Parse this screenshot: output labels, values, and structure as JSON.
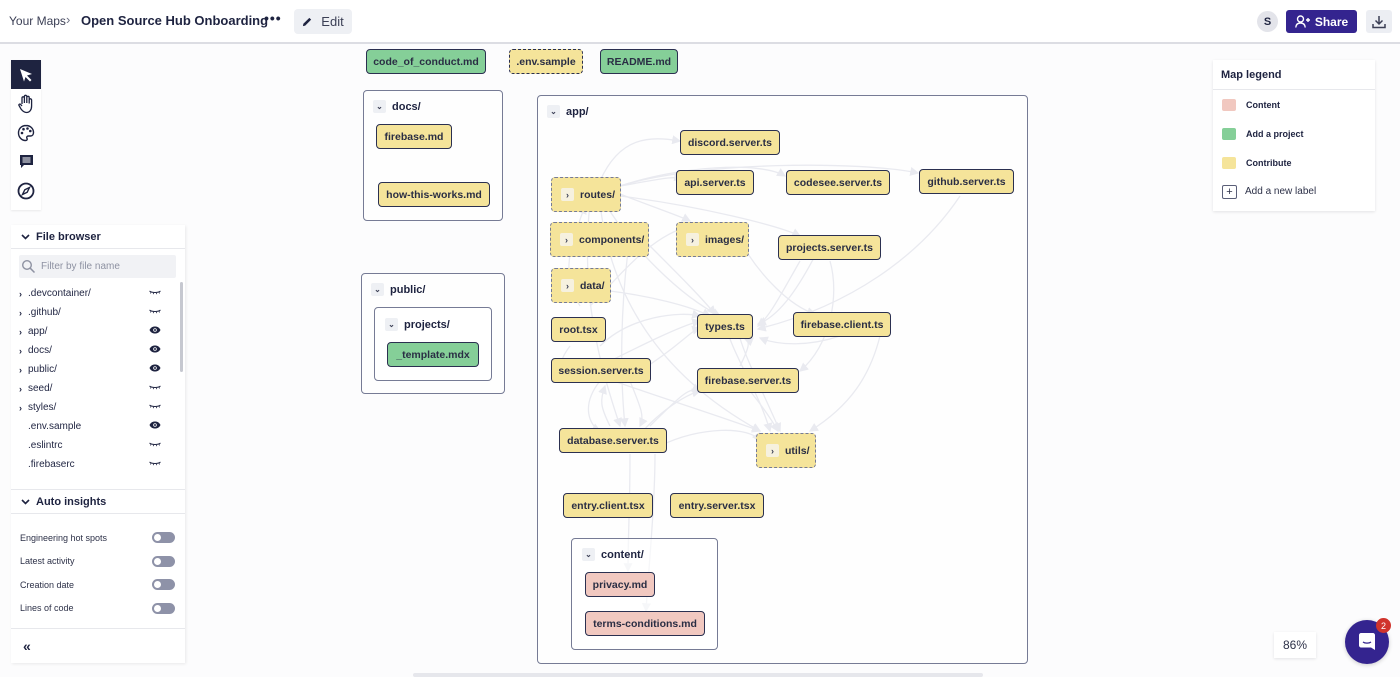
{
  "header": {
    "breadcrumb_root": "Your Maps",
    "breadcrumb_sep": "›",
    "title": "Open Source Hub Onboarding",
    "more_label": "•••",
    "edit_label": "Edit",
    "avatar_initial": "S",
    "share_label": "Share"
  },
  "toolbar": {
    "tools": [
      "select-pointer",
      "pan-hand",
      "palette",
      "comment",
      "compass"
    ],
    "active_tool": "select-pointer"
  },
  "file_browser": {
    "title": "File browser",
    "filter_placeholder": "Filter by file name",
    "items": [
      {
        "name": ".devcontainer/",
        "folder": true,
        "visible": false
      },
      {
        "name": ".github/",
        "folder": true,
        "visible": false
      },
      {
        "name": "app/",
        "folder": true,
        "visible": true
      },
      {
        "name": "docs/",
        "folder": true,
        "visible": true
      },
      {
        "name": "public/",
        "folder": true,
        "visible": true
      },
      {
        "name": "seed/",
        "folder": true,
        "visible": false
      },
      {
        "name": "styles/",
        "folder": true,
        "visible": false
      },
      {
        "name": ".env.sample",
        "folder": false,
        "visible": true
      },
      {
        "name": ".eslintrc",
        "folder": false,
        "visible": false
      },
      {
        "name": ".firebaserc",
        "folder": false,
        "visible": false
      }
    ]
  },
  "auto_insights": {
    "title": "Auto insights",
    "items": [
      {
        "label": "Engineering hot spots",
        "enabled": false
      },
      {
        "label": "Latest activity",
        "enabled": false
      },
      {
        "label": "Creation date",
        "enabled": false
      },
      {
        "label": "Lines of code",
        "enabled": false
      }
    ],
    "collapse_label": "«"
  },
  "legend": {
    "title": "Map legend",
    "items": [
      {
        "label": "Content",
        "color": "#f1c8c0"
      },
      {
        "label": "Add a project",
        "color": "#85cf98"
      },
      {
        "label": "Contribute",
        "color": "#f5e49a"
      }
    ],
    "add_label": "Add a new label"
  },
  "map": {
    "root_files": [
      "code_of_conduct.md",
      ".env.sample",
      "README.md"
    ],
    "groups": {
      "docs": {
        "label": "docs/",
        "files": [
          "firebase.md",
          "how-this-works.md"
        ]
      },
      "public": {
        "label": "public/",
        "sub_label": "projects/",
        "files": [
          "_template.mdx"
        ]
      },
      "app": {
        "label": "app/",
        "folders": [
          "routes/",
          "components/",
          "data/",
          "images/",
          "utils/"
        ],
        "files": [
          "discord.server.ts",
          "api.server.ts",
          "codesee.server.ts",
          "github.server.ts",
          "projects.server.ts",
          "root.tsx",
          "types.ts",
          "firebase.client.ts",
          "session.server.ts",
          "firebase.server.ts",
          "database.server.ts",
          "entry.client.tsx",
          "entry.server.tsx"
        ]
      },
      "content": {
        "label": "content/",
        "files": [
          "privacy.md",
          "terms-conditions.md"
        ]
      }
    }
  },
  "zoom_level": "86%",
  "chat_badge": "2",
  "colors": {
    "brand": "#34248f",
    "content": "#f1c8c0",
    "project": "#85cf98",
    "contribute": "#f5e49a",
    "edge": "#c9cbd9"
  }
}
